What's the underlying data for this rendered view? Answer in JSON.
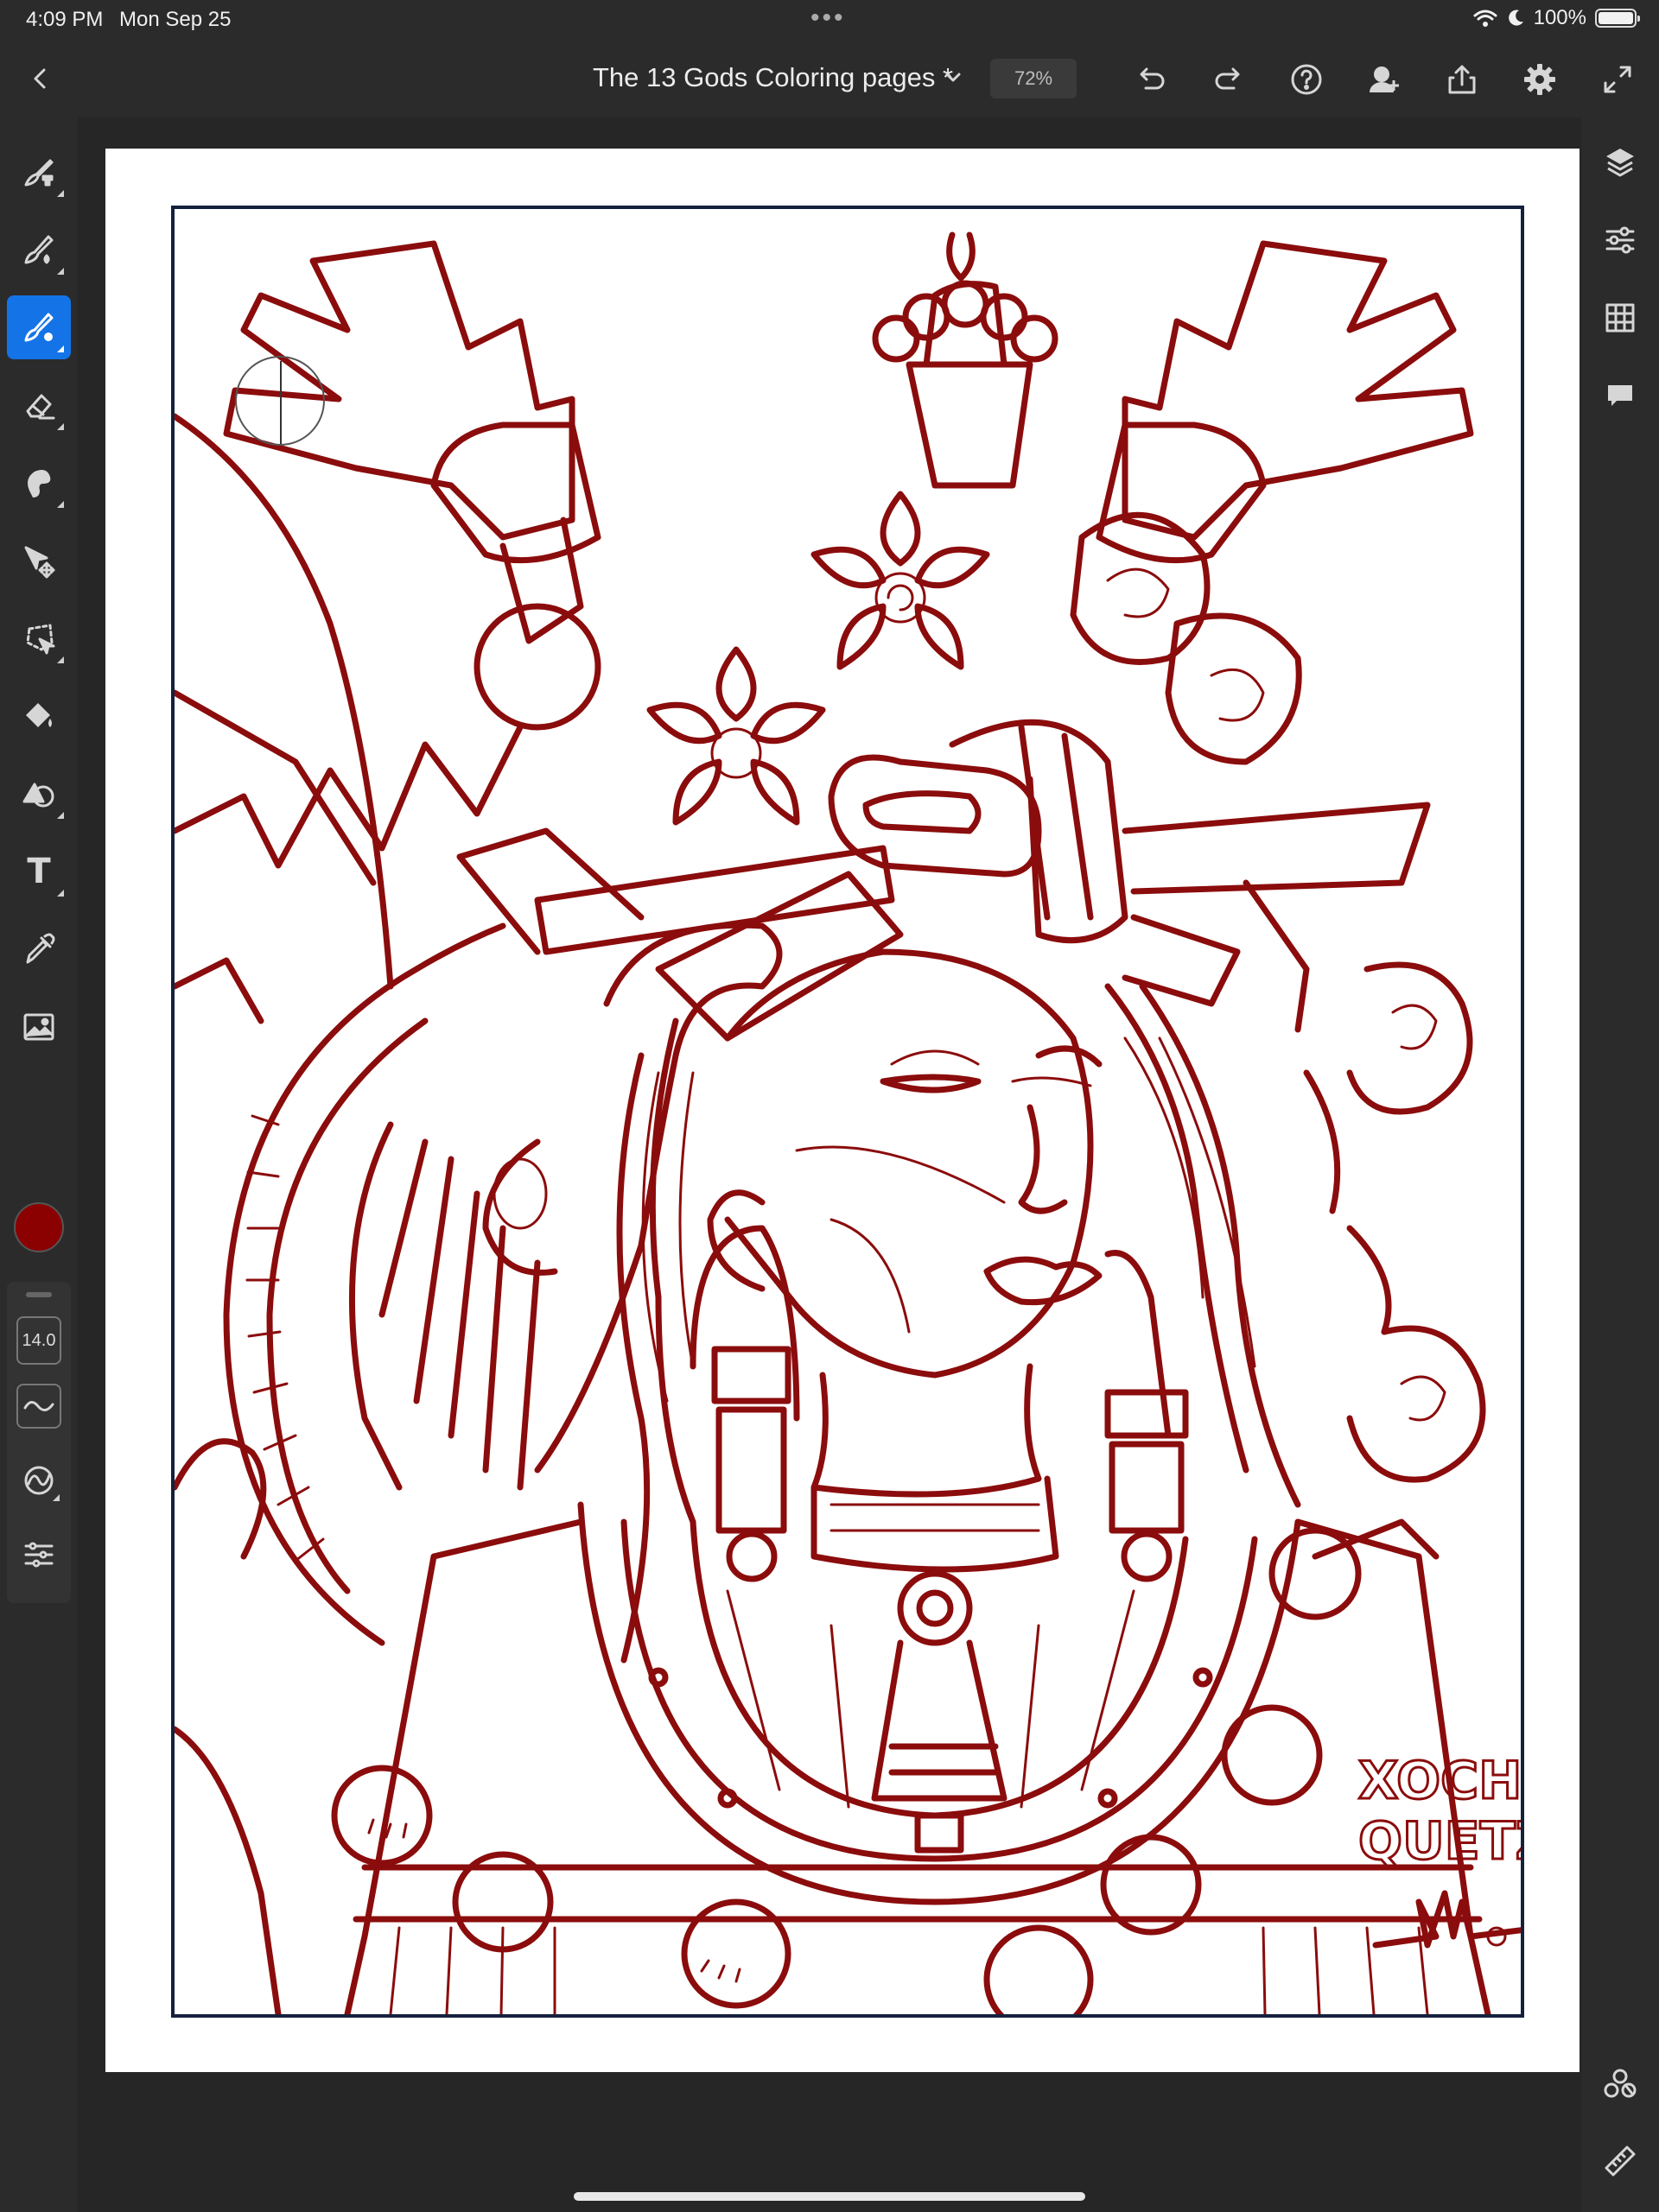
{
  "status_bar": {
    "time": "4:09 PM",
    "date": "Mon Sep 25",
    "battery": "100%",
    "more_dots": "•••"
  },
  "toolbar": {
    "document_title": "The 13 Gods Coloring pages *",
    "zoom": "72%",
    "icons": [
      "chevron-left-icon",
      "chevron-down-icon",
      "undo-icon",
      "redo-icon",
      "help-icon",
      "invite-icon",
      "share-icon",
      "gear-icon",
      "fullscreen-icon"
    ]
  },
  "left_tools": [
    {
      "name": "pixel-brush",
      "icon": "pixel-brush-icon",
      "active": false
    },
    {
      "name": "live-brush",
      "icon": "live-brush-icon",
      "active": false
    },
    {
      "name": "vector-brush",
      "icon": "vector-brush-icon",
      "active": true
    },
    {
      "name": "eraser",
      "icon": "eraser-icon",
      "active": false
    },
    {
      "name": "smudge",
      "icon": "smudge-icon",
      "active": false
    },
    {
      "name": "transform",
      "icon": "move-icon",
      "active": false
    },
    {
      "name": "selection",
      "icon": "lasso-icon",
      "active": false
    },
    {
      "name": "fill",
      "icon": "paint-bucket-icon",
      "active": false
    },
    {
      "name": "shapes",
      "icon": "shapes-icon",
      "active": false
    },
    {
      "name": "text",
      "icon": "text-icon",
      "active": false,
      "glyph": "T"
    },
    {
      "name": "eyedropper",
      "icon": "eyedropper-icon",
      "active": false
    },
    {
      "name": "image",
      "icon": "image-icon",
      "active": false
    }
  ],
  "brush_panel": {
    "color": "#8b0000",
    "size": "14.0",
    "icons": [
      "stroke-smoothing-icon",
      "pressure-icon",
      "brush-settings-icon"
    ]
  },
  "right_tools": [
    "layers-icon",
    "layer-properties-icon",
    "grid-icon",
    "comments-icon",
    "touch-shortcut-icon",
    "ruler-icon"
  ],
  "artwork": {
    "signature_line1": "XOCHI",
    "signature_line2": "QUETZAL",
    "line_color": "#8b0c0c",
    "frame_color": "#14213d"
  }
}
